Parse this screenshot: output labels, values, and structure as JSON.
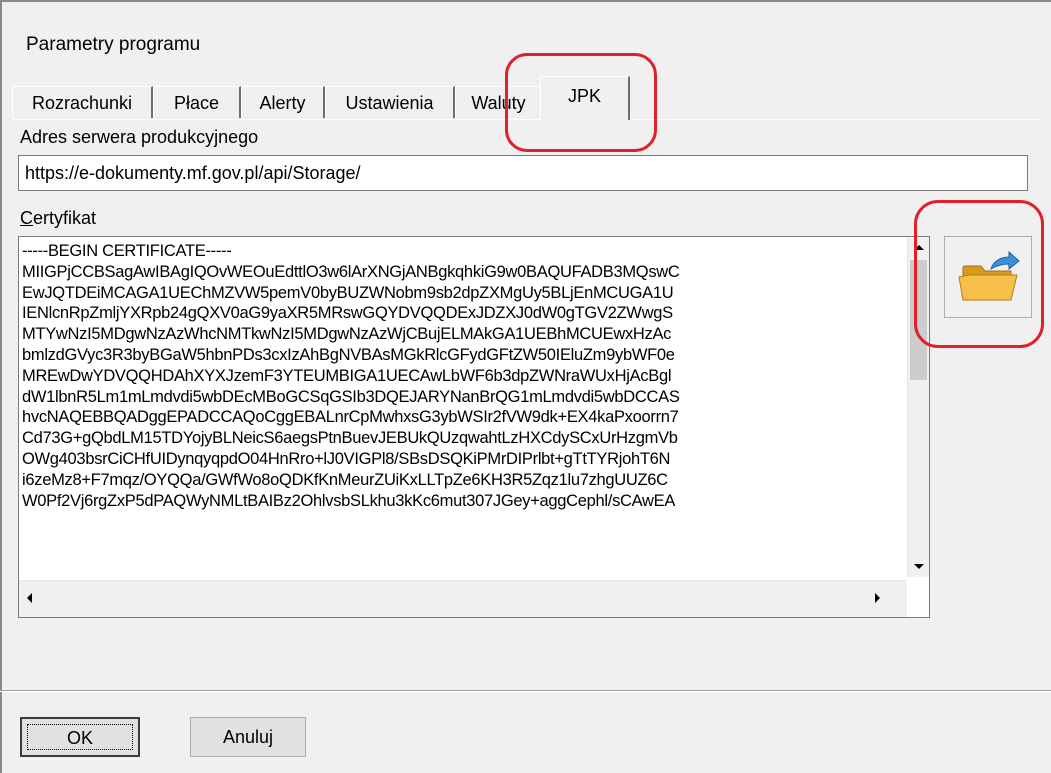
{
  "window": {
    "title": "Parametry programu"
  },
  "tabs": [
    {
      "label": "Rozrachunki"
    },
    {
      "label": "Płace"
    },
    {
      "label": "Alerty"
    },
    {
      "label": "Ustawienia"
    },
    {
      "label": "Waluty"
    },
    {
      "label": "JPK",
      "active": true
    }
  ],
  "server": {
    "label": "Adres serwera produkcyjnego",
    "value": "https://e-dokumenty.mf.gov.pl/api/Storage/"
  },
  "certificate": {
    "label_underlined": "C",
    "label_rest": "ertyfikat",
    "lines": [
      "-----BEGIN CERTIFICATE-----",
      "MIIGPjCCBSagAwIBAgIQOvWEOuEdttlO3w6lArXNGjANBgkqhkiG9w0BAQUFADB3MQswC",
      "EwJQTDEiMCAGA1UEChMZVW5pemV0byBUZWNobm9sb2dpZXMgUy5BLjEnMCUGA1U",
      "IENlcnRpZmljYXRpb24gQXV0aG9yaXR5MRswGQYDVQQDExJDZXJ0dW0gTGV2ZWwgS",
      "MTYwNzI5MDgwNzAzWhcNMTkwNzI5MDgwNzAzWjCBujELMAkGA1UEBhMCUEwxHzAc",
      "bmlzdGVyc3R3byBGaW5hbnPDs3cxIzAhBgNVBAsMGkRlcGFydGFtZW50IEluZm9ybWF0e",
      "MREwDwYDVQQHDAhXYXJzemF3YTEUMBIGA1UECAwLbWF6b3dpZWNraWUxHjAcBgl",
      "dW1lbnR5Lm1mLmdvdi5wbDEcMBoGCSqGSIb3DQEJARYNanBrQG1mLmdvdi5wbDCCAS",
      "hvcNAQEBBQADggEPADCCAQoCggEBALnrCpMwhxsG3ybWSIr2fVW9dk+EX4kaPxoorrn7",
      "Cd73G+gQbdLM15TDYojyBLNeicS6aegsPtnBuevJEBUkQUzqwahtLzHXCdySCxUrHzgmVb",
      "OWg403bsrCiCHfUIDynqyqpdO04HnRro+lJ0VIGPl8/SBsDSQKiPMrDIPrlbt+gTtTYRjohT6N",
      "i6zeMz8+F7mqz/OYQQa/GWfWo8oQDKfKnMeurZUiKxLLTpZe6KH3R5Zqz1lu7zhgUUZ6C",
      "W0Pf2Vj6rgZxP5dPAQWyNMLtBAIBz2OhlvsbSLkhu3kKc6mut307JGey+aggCephl/sCAwEA"
    ]
  },
  "buttons": {
    "ok": "OK",
    "cancel": "Anuluj"
  },
  "icons": {
    "browse": "folder-open-icon"
  },
  "colors": {
    "highlight": "#e0202a",
    "folder": "#f4b63c",
    "arrow": "#3d8fd8"
  }
}
